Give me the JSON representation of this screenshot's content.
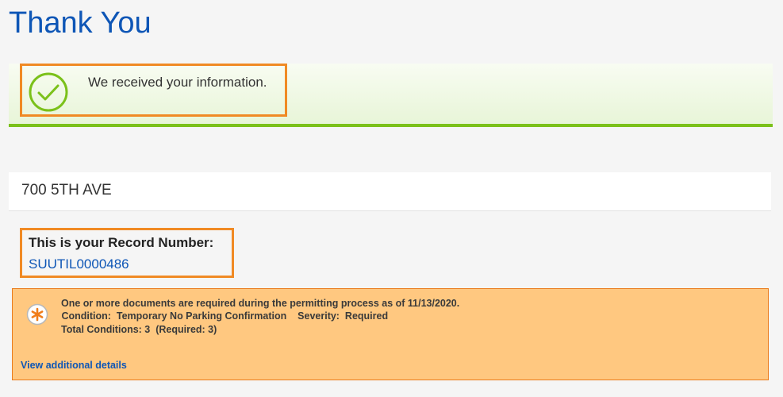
{
  "page": {
    "title": "Thank You"
  },
  "success": {
    "message": "We received your information."
  },
  "address": {
    "text": "700 5TH AVE"
  },
  "record": {
    "label": "This is your Record Number:",
    "number": "SUUTIL0000486"
  },
  "conditions": {
    "line1": "One or more documents are required during the permitting process as of 11/13/2020.",
    "line2": " Condition:  Temporary No Parking Confirmation    Severity:  Required",
    "line3": "Total Conditions: 3  (Required: 3)",
    "details_link": "View additional details"
  },
  "colors": {
    "accent": "#0e56b6",
    "success_bar": "#7bc11a",
    "highlight": "#f08a24",
    "condition_bg": "#ffc880"
  },
  "icons": {
    "success": "checkmark-circle-icon",
    "condition": "asterisk-icon"
  }
}
